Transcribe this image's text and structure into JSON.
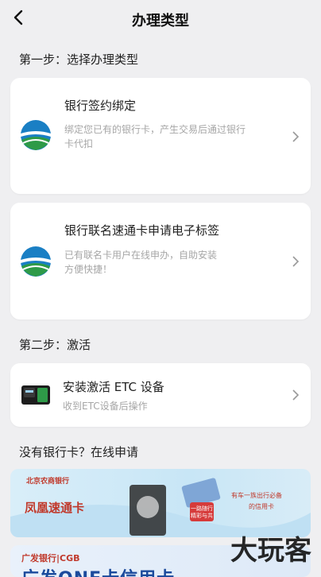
{
  "header": {
    "title": "办理类型"
  },
  "sections": {
    "step1": "第一步：选择办理类型",
    "step2": "第二步：激活",
    "apply": "没有银行卡？在线申请"
  },
  "cards": [
    {
      "title": "银行签约绑定",
      "desc_line1": "绑定您已有的银行卡，产生交易后通过银行",
      "desc_line2": "卡代扣",
      "icon": "bank-logo-icon"
    },
    {
      "title": "银行联名速通卡申请电子标签",
      "desc_line1": "已有联名卡用户在线申办，自助安装",
      "desc_line2": "方便快捷！",
      "icon": "bank-logo-icon"
    },
    {
      "title": "安装激活 ETC 设备",
      "desc_line1": "收到ETC设备后操作",
      "icon": "etc-device-icon"
    }
  ],
  "banners": {
    "b1": {
      "logo_text": "北京农商银行",
      "main": "凤凰速通卡",
      "right_text_1": "有车一族出行必备",
      "right_text_2": "的信用卡",
      "chip": "一路随行 精彩与共"
    },
    "b2": {
      "logo_text": "广发银行|CGB",
      "main": "广发ONE卡信用卡"
    }
  },
  "watermark": "大玩客",
  "colors": {
    "bg": "#efeff1",
    "card": "#ffffff",
    "accent_green": "#2e9a48",
    "accent_blue": "#1a7fc4"
  }
}
